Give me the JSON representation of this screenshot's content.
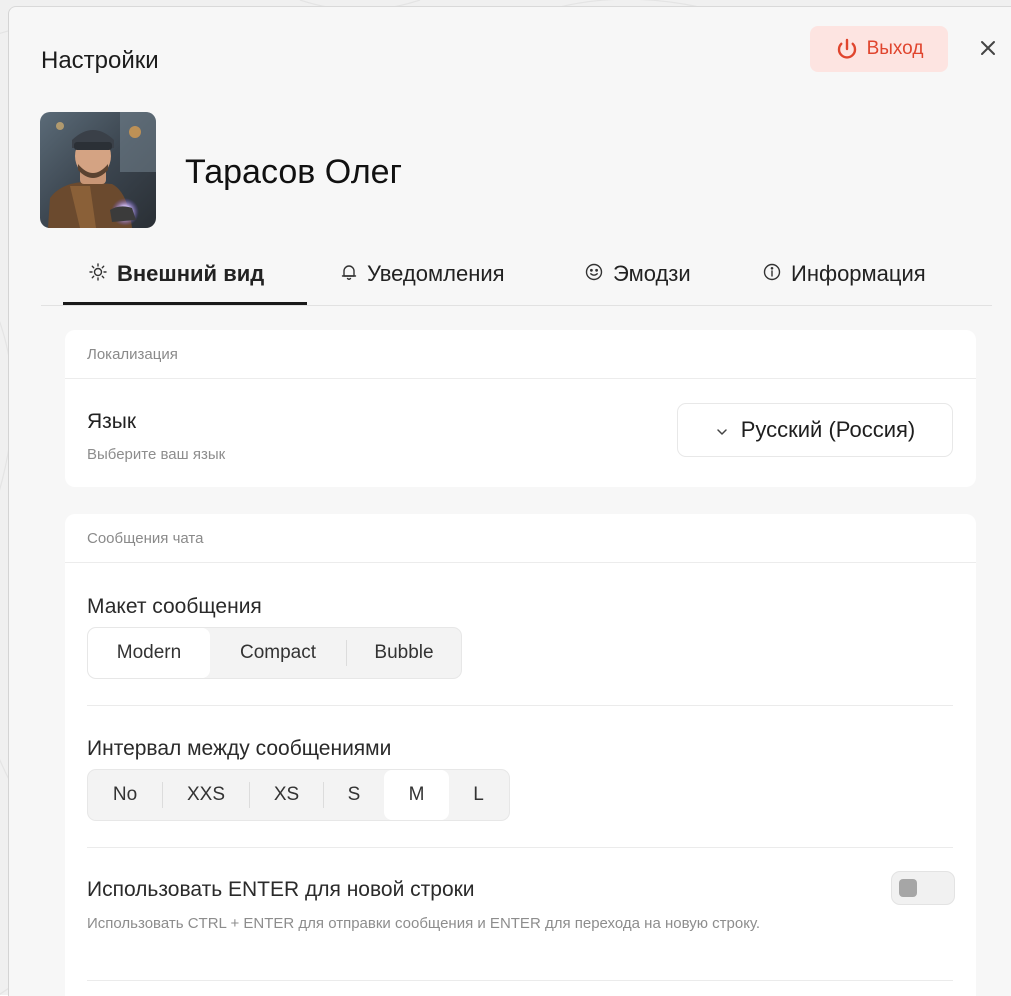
{
  "dialog": {
    "title": "Настройки",
    "logout_label": "Выход",
    "accent_color": "#e0452e"
  },
  "profile": {
    "name": "Тарасов Олег"
  },
  "tabs": [
    {
      "label": "Внешний вид",
      "icon": "sun-icon",
      "active": true
    },
    {
      "label": "Уведомления",
      "icon": "bell-icon",
      "active": false
    },
    {
      "label": "Эмодзи",
      "icon": "smile-icon",
      "active": false
    },
    {
      "label": "Информация",
      "icon": "info-icon",
      "active": false
    }
  ],
  "localization": {
    "header": "Локализация",
    "language_label": "Язык",
    "language_hint": "Выберите ваш язык",
    "language_value": "Русский (Россия)"
  },
  "chat": {
    "header": "Сообщения чата",
    "layout_label": "Макет сообщения",
    "layout_options": [
      "Modern",
      "Compact",
      "Bubble"
    ],
    "layout_selected": "Modern",
    "spacing_label": "Интервал между сообщениями",
    "spacing_options": [
      "No",
      "XXS",
      "XS",
      "S",
      "M",
      "L"
    ],
    "spacing_selected": "M",
    "enter_label": "Использовать ENTER для новой строки",
    "enter_description": "Использовать CTRL + ENTER для отправки сообщения и ENTER для перехода на новую строку.",
    "enter_enabled": false
  }
}
